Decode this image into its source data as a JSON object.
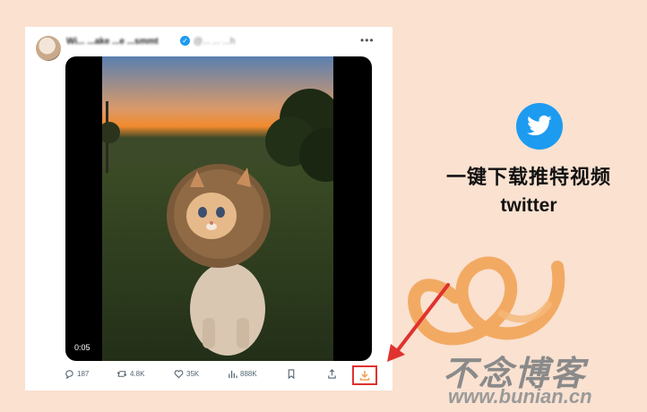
{
  "tweet": {
    "author_name": "Wi... ...ake ...e ...smmt",
    "author_handle": "@... ... ...h",
    "more_icon": "more-horizontal-icon",
    "verified_icon": "verified-badge-icon",
    "video": {
      "timestamp": "0:05",
      "subject": "cat-in-lion-mane-costume"
    },
    "actions": {
      "replies": "187",
      "reposts": "4.8K",
      "likes": "35K",
      "views": "888K"
    }
  },
  "promo": {
    "headline": "一键下载推特视频",
    "subline": "twitter",
    "logo_icon": "twitter-bird-icon"
  },
  "watermark": {
    "text": "不念博客",
    "url": "www.bunian.cn"
  },
  "colors": {
    "background": "#fae1d0",
    "twitter_blue": "#1d9bf0",
    "highlight_red": "#e0322f",
    "accent_orange": "#f0a050"
  }
}
